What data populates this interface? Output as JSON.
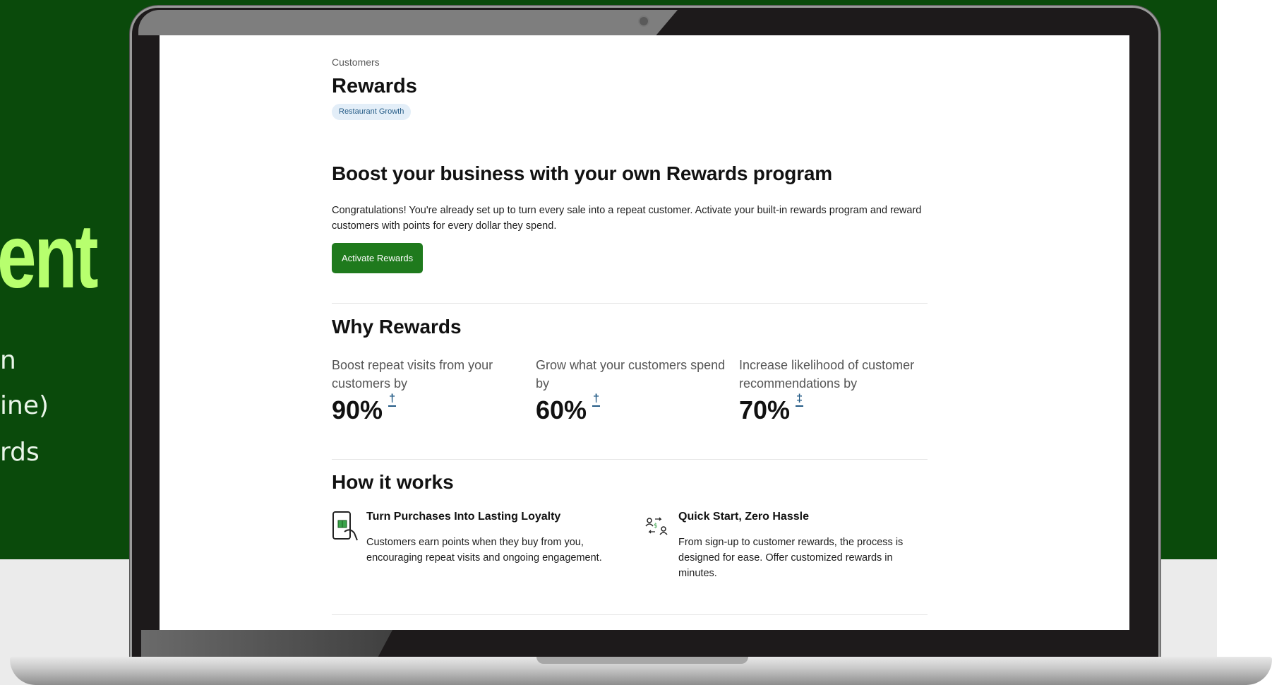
{
  "marketing": {
    "hero_word": "ent",
    "lines": [
      "n",
      "ine)",
      "rds"
    ]
  },
  "page": {
    "breadcrumb": "Customers",
    "title": "Rewards",
    "tag": "Restaurant Growth"
  },
  "hero": {
    "heading": "Boost your business with your own Rewards program",
    "body": "Congratulations! You're already set up to turn every sale into a repeat customer. Activate your built-in rewards program and reward customers with points for every dollar they spend.",
    "cta_label": "Activate Rewards"
  },
  "why": {
    "heading": "Why Rewards",
    "stats": [
      {
        "label": "Boost repeat visits from your customers by",
        "value": "90%",
        "footnote": "†"
      },
      {
        "label": "Grow what your customers spend by",
        "value": "60%",
        "footnote": "†"
      },
      {
        "label": "Increase likelihood of customer recommendations by",
        "value": "70%",
        "footnote": "‡"
      }
    ]
  },
  "how": {
    "heading": "How it works",
    "items": [
      {
        "icon": "phone-gift-icon",
        "title": "Turn Purchases Into Lasting Loyalty",
        "text": "Customers earn points when they buy from you, encouraging repeat visits and ongoing engagement."
      },
      {
        "icon": "people-exchange-icon",
        "title": "Quick Start, Zero Hassle",
        "text": "From sign-up to customer rewards, the process is designed for ease. Offer customized rewards in minutes."
      }
    ]
  },
  "colors": {
    "background_green": "#0a4a0b",
    "hero_text_green": "#b7ff6e",
    "button_green": "#1f7a1d",
    "pill_bg": "#e3eef8",
    "link_blue": "#245b86"
  }
}
